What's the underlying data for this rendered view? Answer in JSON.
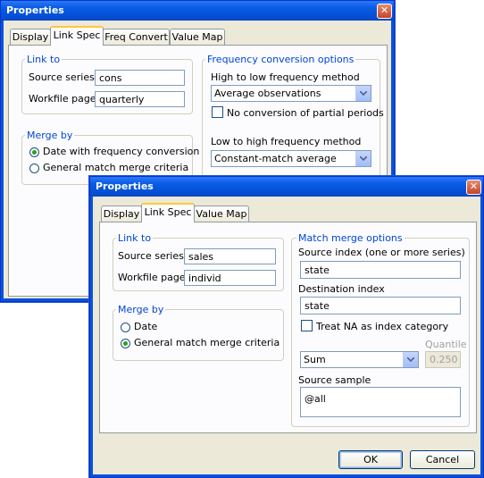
{
  "back": {
    "title": "Properties",
    "tabs": [
      "Display",
      "Link Spec",
      "Freq Convert",
      "Value Map"
    ],
    "link_to": {
      "legend": "Link to",
      "source_label": "Source series:",
      "source_value": "cons",
      "page_label": "Workfile page:",
      "page_value": "quarterly"
    },
    "freq": {
      "legend": "Frequency conversion options",
      "high_low_label": "High to low frequency method",
      "high_low_value": "Average observations",
      "partial_label": "No conversion of partial periods",
      "low_high_label": "Low to high frequency method",
      "low_high_value": "Constant-match average"
    },
    "merge": {
      "legend": "Merge by",
      "opt1": "Date with frequency conversion",
      "opt2": "General match merge criteria"
    }
  },
  "front": {
    "title": "Properties",
    "tabs": [
      "Display",
      "Link Spec",
      "Value Map"
    ],
    "link_to": {
      "legend": "Link to",
      "source_label": "Source series:",
      "source_value": "sales",
      "page_label": "Workfile page:",
      "page_value": "individ"
    },
    "merge": {
      "legend": "Merge by",
      "opt1": "Date",
      "opt2": "General match merge criteria"
    },
    "match": {
      "legend": "Match merge options",
      "source_index_label": "Source index (one or more series)",
      "source_index_value": "state",
      "dest_index_label": "Destination index",
      "dest_index_value": "state",
      "treat_na_label": "Treat NA as index category",
      "quantile_label": "Quantile",
      "method_value": "Sum",
      "quantile_value": "0.250",
      "sample_label": "Source sample",
      "sample_value": "@all"
    },
    "ok_label": "OK",
    "cancel_label": "Cancel"
  },
  "close_glyph": "✕"
}
